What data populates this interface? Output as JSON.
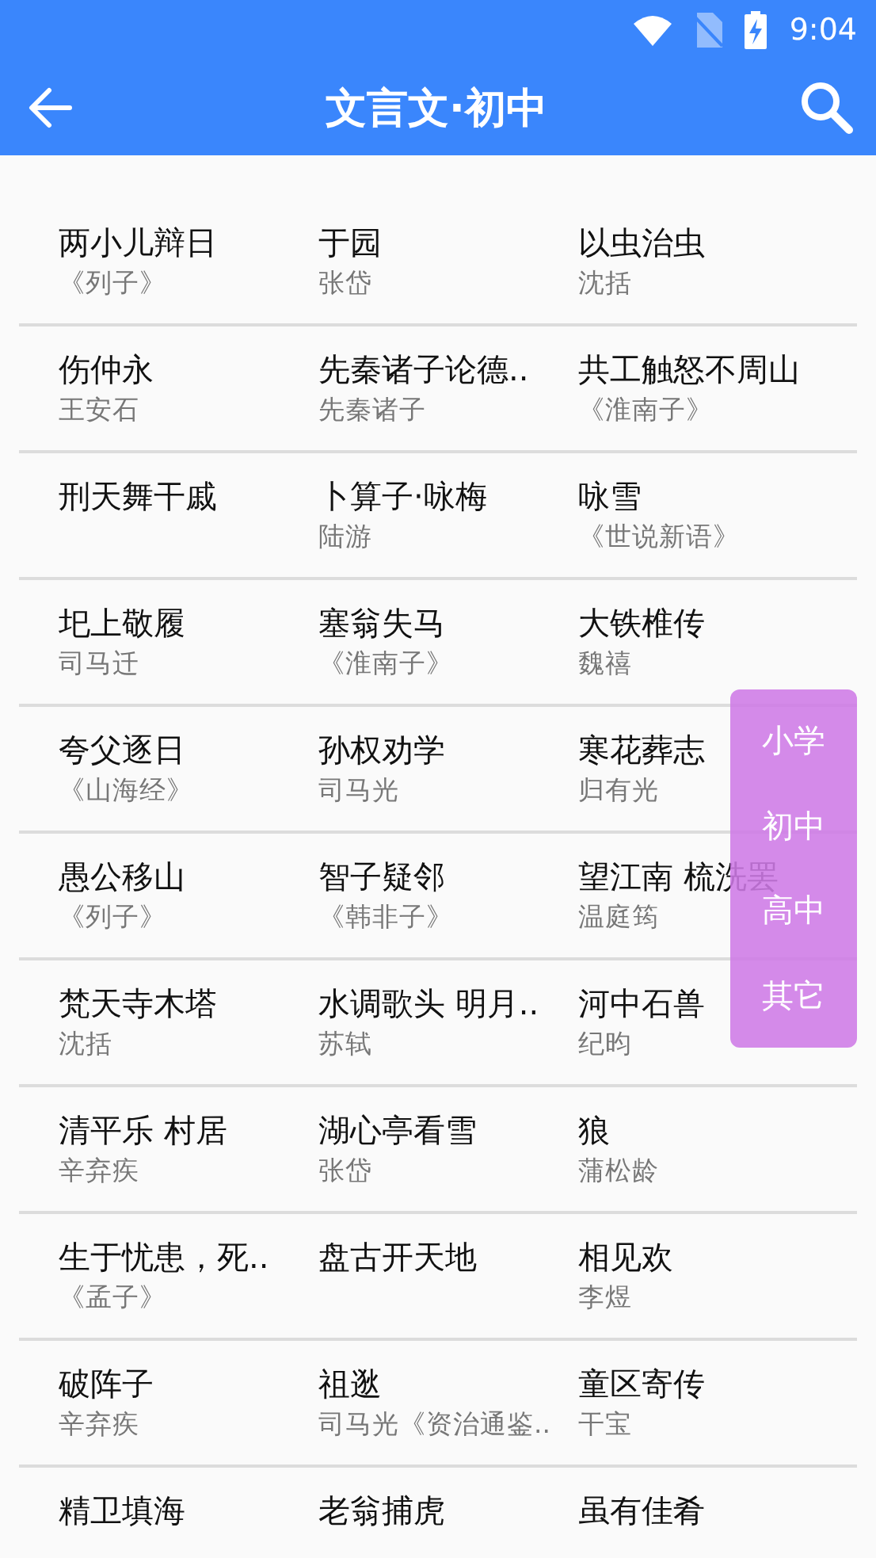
{
  "status_bar": {
    "time": "9:04"
  },
  "app_bar": {
    "title": "文言文·初中"
  },
  "rows": [
    [
      {
        "title": "两小儿辩日",
        "author": "《列子》"
      },
      {
        "title": "于园",
        "author": "张岱"
      },
      {
        "title": "以虫治虫",
        "author": "沈括"
      }
    ],
    [
      {
        "title": "伤仲永",
        "author": "王安石"
      },
      {
        "title": "先秦诸子论德..",
        "author": "先秦诸子"
      },
      {
        "title": "共工触怒不周山",
        "author": "《淮南子》"
      }
    ],
    [
      {
        "title": "刑天舞干戚"
      },
      {
        "title": "卜算子·咏梅",
        "author": "陆游"
      },
      {
        "title": "咏雪",
        "author": "《世说新语》"
      }
    ],
    [
      {
        "title": "圯上敬履",
        "author": "司马迁"
      },
      {
        "title": "塞翁失马",
        "author": "《淮南子》"
      },
      {
        "title": "大铁椎传",
        "author": "魏禧"
      }
    ],
    [
      {
        "title": "夸父逐日",
        "author": "《山海经》"
      },
      {
        "title": "孙权劝学",
        "author": "司马光"
      },
      {
        "title": "寒花葬志",
        "author": "归有光"
      }
    ],
    [
      {
        "title": "愚公移山",
        "author": "《列子》"
      },
      {
        "title": "智子疑邻",
        "author": "《韩非子》"
      },
      {
        "title": "望江南 梳洗罢",
        "author": "温庭筠"
      }
    ],
    [
      {
        "title": "梵天寺木塔",
        "author": "沈括"
      },
      {
        "title": "水调歌头 明月..",
        "author": "苏轼"
      },
      {
        "title": "河中石兽",
        "author": "纪昀"
      }
    ],
    [
      {
        "title": "清平乐 村居",
        "author": "辛弃疾"
      },
      {
        "title": "湖心亭看雪",
        "author": "张岱"
      },
      {
        "title": "狼",
        "author": "蒲松龄"
      }
    ],
    [
      {
        "title": "生于忧患，死..",
        "author": "《孟子》"
      },
      {
        "title": "盘古开天地"
      },
      {
        "title": "相见欢",
        "author": "李煜"
      }
    ],
    [
      {
        "title": "破阵子",
        "author": "辛弃疾"
      },
      {
        "title": "祖逖",
        "author": "司马光《资治通鉴.."
      },
      {
        "title": "童区寄传",
        "author": "干宝"
      }
    ],
    [
      {
        "title": "精卫填海"
      },
      {
        "title": "老翁捕虎"
      },
      {
        "title": "虽有佳肴"
      }
    ]
  ],
  "level_menu": [
    "小学",
    "初中",
    "高中",
    "其它"
  ]
}
